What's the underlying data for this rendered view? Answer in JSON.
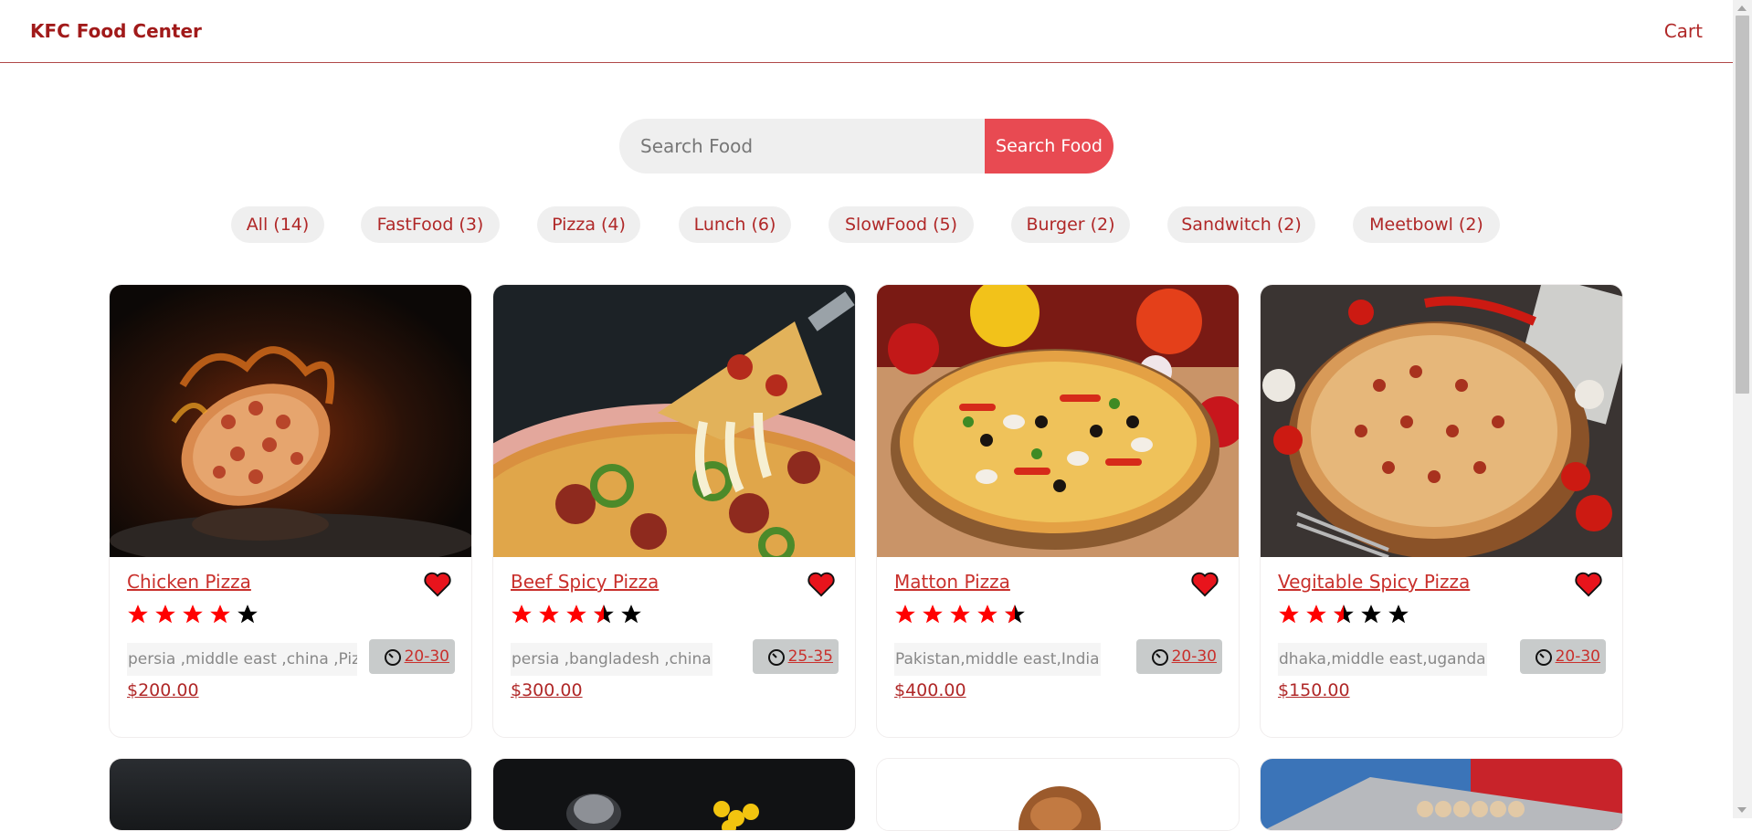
{
  "header": {
    "brand": "KFC Food Center",
    "cart_label": "Cart"
  },
  "search": {
    "placeholder": "Search Food",
    "value": "",
    "button_label": "Search Food"
  },
  "categories": [
    {
      "label": "All (14)"
    },
    {
      "label": "FastFood (3)"
    },
    {
      "label": "Pizza (4)"
    },
    {
      "label": "Lunch (6)"
    },
    {
      "label": "SlowFood (5)"
    },
    {
      "label": "Burger (2)"
    },
    {
      "label": "Sandwitch (2)"
    },
    {
      "label": "Meetbowl (2)"
    }
  ],
  "foods": [
    {
      "name": "Chicken Pizza",
      "stars": 4,
      "origins": "persia ,middle east ,china ,Pizza",
      "cook_time": "20-30",
      "price": "$200.00"
    },
    {
      "name": "Beef Spicy Pizza",
      "stars": 3.5,
      "origins": "persia ,bangladesh ,china",
      "cook_time": "25-35",
      "price": "$300.00"
    },
    {
      "name": "Matton Pizza",
      "stars": 4.5,
      "origins": "Pakistan,middle east,India",
      "cook_time": "20-30",
      "price": "$400.00"
    },
    {
      "name": "Vegitable Spicy Pizza",
      "stars": 2.5,
      "origins": "dhaka,middle east,uganda",
      "cook_time": "20-30",
      "price": "$150.00"
    }
  ],
  "icons": {
    "favorite": "heart-icon",
    "rating": "star-icon",
    "time": "clock-icon"
  },
  "colors": {
    "brand": "#a11a1a",
    "accent": "#e84a52",
    "star_filled": "#ff0000",
    "star_empty": "#000000"
  }
}
